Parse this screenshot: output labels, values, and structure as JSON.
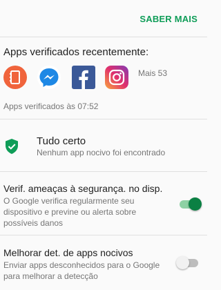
{
  "header": {
    "learn_more": "SABER MAIS"
  },
  "recent": {
    "title": "Apps verificados recentemente:",
    "apps": [
      {
        "icon": "notebook-app-icon"
      },
      {
        "icon": "messenger-icon"
      },
      {
        "icon": "facebook-icon"
      },
      {
        "icon": "instagram-icon"
      }
    ],
    "more": "Mais 53",
    "verified_time": "Apps verificados às 07:52"
  },
  "status": {
    "icon": "shield-check-icon",
    "title": "Tudo certo",
    "subtitle": "Nenhum app nocivo foi encontrado"
  },
  "settings": [
    {
      "title": "Verif. ameaças à segurança. no disp.",
      "desc": "O Google verifica regularmente seu dispositivo e previne ou alerta sobre possíveis danos",
      "enabled": true
    },
    {
      "title": "Melhorar det. de apps nocivos",
      "desc": "Enviar apps desconhecidos para o Google para melhorar a detecção",
      "enabled": false
    }
  ],
  "colors": {
    "accent": "#0f9d58",
    "toggle_on": "#0b8043",
    "divider": "#e0e0e0"
  }
}
